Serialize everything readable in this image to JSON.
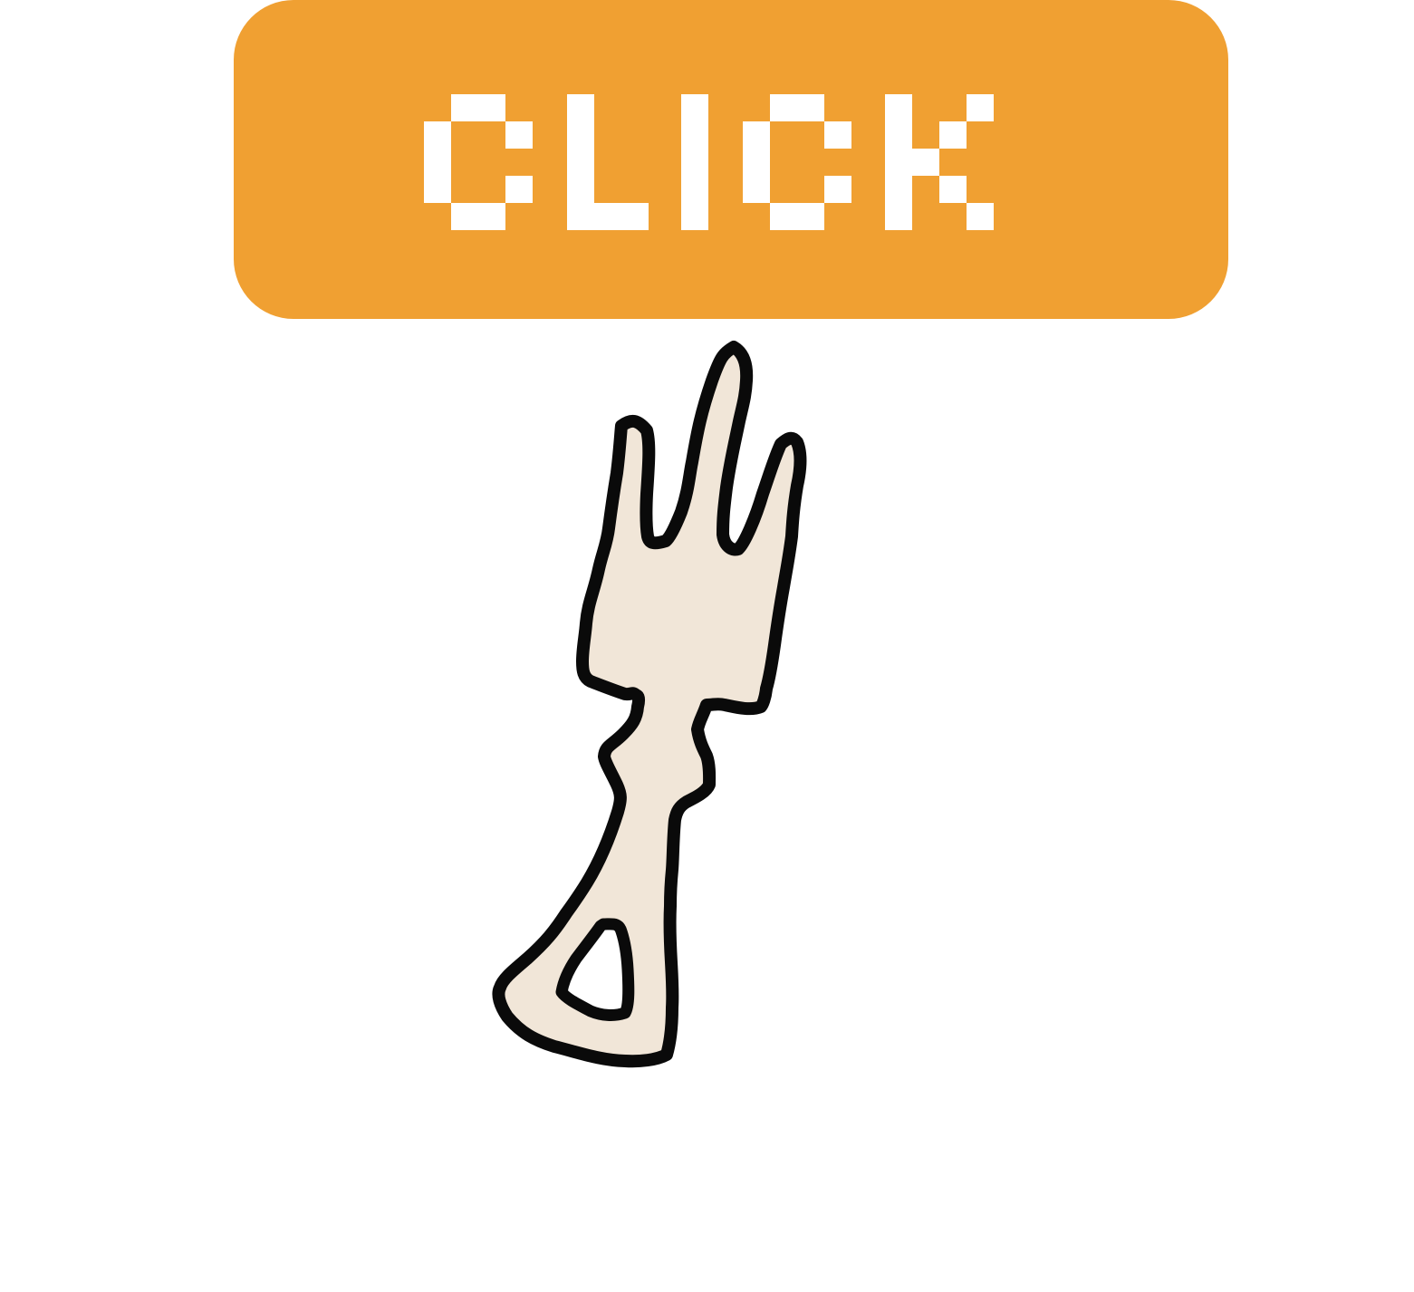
{
  "button": {
    "label": "CLICK"
  },
  "colors": {
    "button_background": "#f0a032",
    "button_text": "#ffffff",
    "fork_fill": "#f1e6d8",
    "fork_outline": "#0a0a0a",
    "page_background": "#ffffff"
  },
  "icons": {
    "illustration": "fork-icon"
  }
}
